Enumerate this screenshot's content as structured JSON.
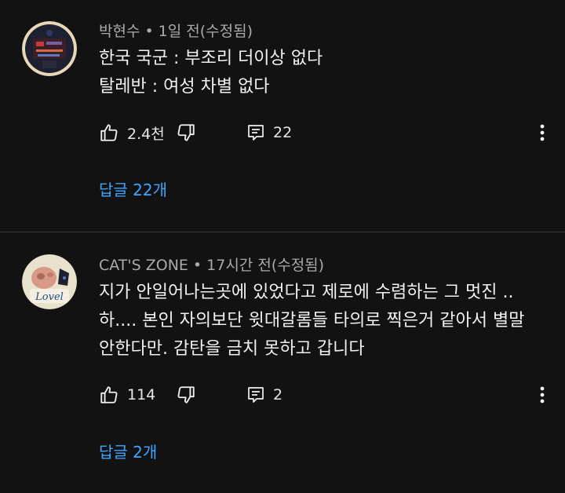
{
  "comments": [
    {
      "author": "박현수",
      "meta_sep": "•",
      "time": "1일 전(수정됨)",
      "lines": [
        "한국 국군 : 부조리 더이상 없다",
        "탈레반 : 여성 차별 없다"
      ],
      "likes": "2.4천",
      "reply_count": "22",
      "replies_label": "답글 22개"
    },
    {
      "author": "CAT'S ZONE",
      "meta_sep": "•",
      "time": "17시간 전(수정됨)",
      "lines": [
        "지가 안일어나는곳에 있었다고 제로에 수렴하는 그 멋진 ..",
        "하.... 본인 자의보단 윗대갈롬들 타의로 찍은거 같아서 별말",
        "안한다만. 감탄을 금치 못하고 갑니다"
      ],
      "likes": "114",
      "reply_count": "2",
      "replies_label": "답글 2개",
      "avatar_text": "Lovel"
    }
  ],
  "icons": {
    "like": "thumbs-up-icon",
    "dislike": "thumbs-down-icon",
    "reply": "comment-icon",
    "more": "more-vertical-icon"
  },
  "colors": {
    "background": "#121212",
    "link": "#3ea6ff",
    "meta": "#aaaaaa"
  }
}
